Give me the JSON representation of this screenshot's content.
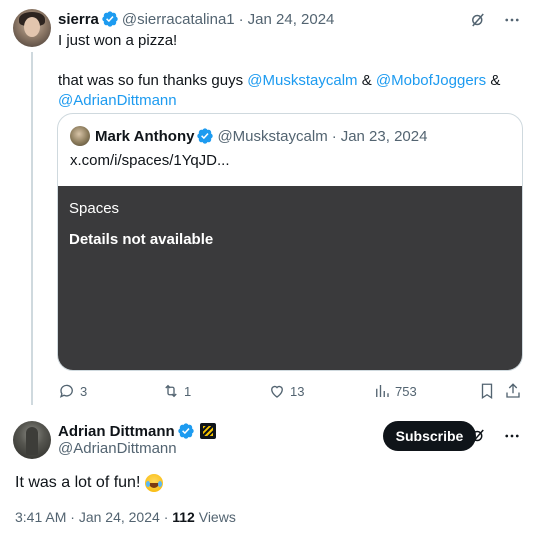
{
  "tweet": {
    "author_name": "sierra",
    "author_handle": "@sierracatalina1",
    "separator": "·",
    "date": "Jan 24, 2024",
    "text_line1": "I just won a pizza!",
    "text_line2_prefix": "that was so fun thanks guys",
    "mention1": "@Muskstaycalm",
    "amp1": "&",
    "mention2": "@MobofJoggers",
    "amp2": "&",
    "mention3": "@AdrianDittmann",
    "quote": {
      "author_name": "Mark Anthony",
      "author_handle": "@Muskstaycalm",
      "separator": "·",
      "date": "Jan 23, 2024",
      "link": "x.com/i/spaces/1YqJD...",
      "card_title": "Spaces",
      "card_detail": "Details not available"
    },
    "stats": {
      "replies": "3",
      "reposts": "1",
      "likes": "13",
      "views": "753"
    }
  },
  "reply": {
    "author_name": "Adrian Dittmann",
    "author_handle": "@AdrianDittmann",
    "subscribe_label": "Subscribe",
    "text": "It was a lot of fun!",
    "time": "3:41 AM",
    "separator": "·",
    "date": "Jan 24, 2024",
    "views_count": "112",
    "views_label": "Views"
  },
  "icons": {
    "verified": "verified-badge-icon",
    "grok": "grok-icon",
    "more": "more-icon",
    "reply": "reply-icon",
    "repost": "repost-icon",
    "like": "heart-icon",
    "views": "views-icon",
    "bookmark": "bookmark-icon",
    "share": "share-icon"
  },
  "colors": {
    "accent": "#1d9bf0",
    "muted": "#536471",
    "text": "#0f1419",
    "spaces_card": "#3a3a3c"
  }
}
